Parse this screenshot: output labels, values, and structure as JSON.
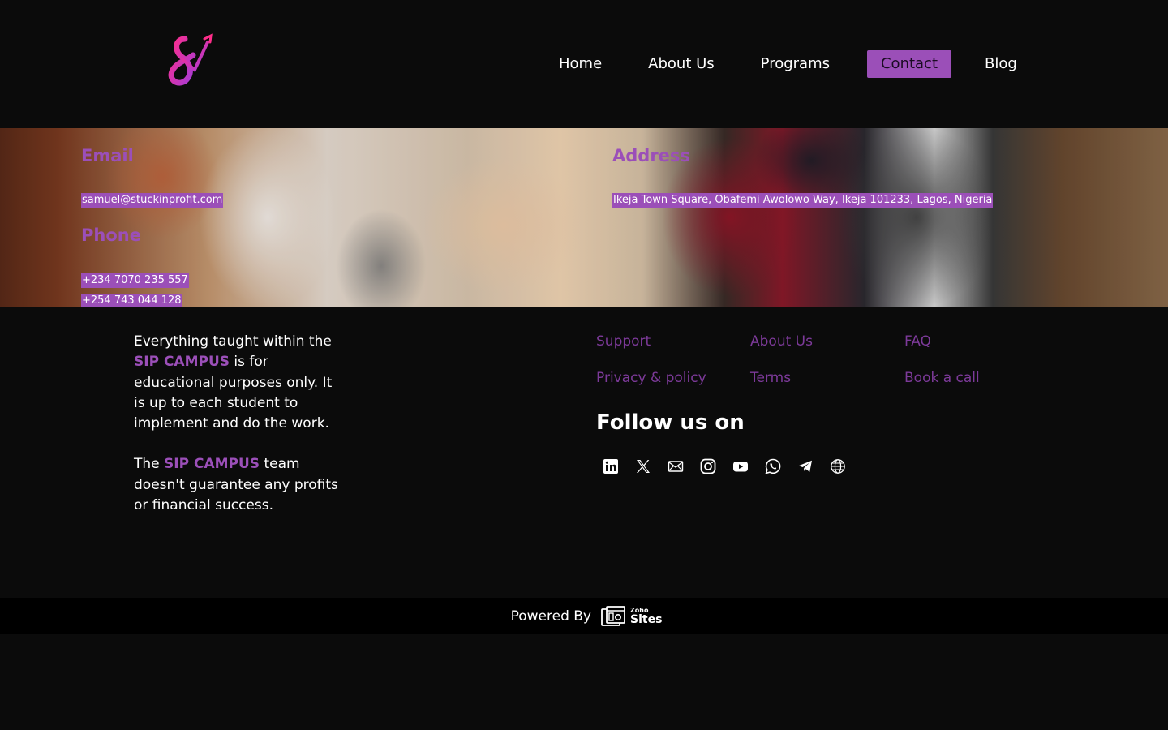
{
  "colors": {
    "accent": "#9b4fb8",
    "link": "#7d3a9a",
    "background": "#0b0b0b",
    "logo_gradient_start": "#ff2d8a",
    "logo_gradient_end": "#a43cd8"
  },
  "header": {
    "logo_icon": "sip-campus-logo-icon",
    "nav": [
      {
        "label": "Home"
      },
      {
        "label": "About Us"
      },
      {
        "label": "Programs"
      },
      {
        "label": "Contact",
        "active": true
      },
      {
        "label": "Blog"
      }
    ]
  },
  "contact": {
    "email_heading": "Email",
    "email_value": "samuel@stuckinprofit.com",
    "phone_heading": "Phone",
    "phones": [
      "+234 7070 235 557",
      "+254 743 044 128"
    ],
    "address_heading": "Address",
    "address_value": "Ikeja Town Square, Obafemi Awolowo Way, Ikeja 101233, Lagos, Nigeria"
  },
  "footer": {
    "disclaimer1": {
      "before": "Everything taught within the ",
      "highlight": "SIP CAMPUS",
      "after": " is for educational purposes only. It is up to each student to implement and do the work."
    },
    "disclaimer2": {
      "before": "The ",
      "highlight": "SIP CAMPUS",
      "after": " team doesn't guarantee any profits or financial success."
    },
    "links": [
      "Support",
      "About Us",
      "FAQ",
      "Privacy & policy",
      "Terms",
      "Book a call"
    ],
    "follow_heading": "Follow us on",
    "socials": [
      "linkedin-icon",
      "x-icon",
      "email-icon",
      "instagram-icon",
      "youtube-icon",
      "whatsapp-icon",
      "telegram-icon",
      "globe-icon"
    ]
  },
  "powered": {
    "label": "Powered By",
    "brand_small": "Zoho",
    "brand_big": "Sites"
  }
}
